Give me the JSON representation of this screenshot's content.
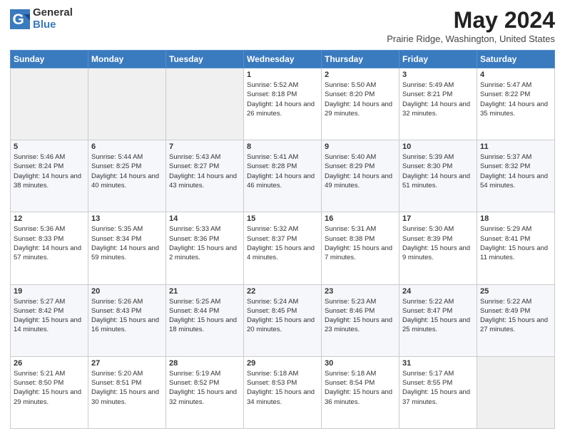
{
  "logo": {
    "general": "General",
    "blue": "Blue"
  },
  "title": {
    "month": "May 2024",
    "location": "Prairie Ridge, Washington, United States"
  },
  "weekdays": [
    "Sunday",
    "Monday",
    "Tuesday",
    "Wednesday",
    "Thursday",
    "Friday",
    "Saturday"
  ],
  "weeks": [
    [
      {
        "day": "",
        "info": ""
      },
      {
        "day": "",
        "info": ""
      },
      {
        "day": "",
        "info": ""
      },
      {
        "day": "1",
        "info": "Sunrise: 5:52 AM\nSunset: 8:18 PM\nDaylight: 14 hours\nand 26 minutes."
      },
      {
        "day": "2",
        "info": "Sunrise: 5:50 AM\nSunset: 8:20 PM\nDaylight: 14 hours\nand 29 minutes."
      },
      {
        "day": "3",
        "info": "Sunrise: 5:49 AM\nSunset: 8:21 PM\nDaylight: 14 hours\nand 32 minutes."
      },
      {
        "day": "4",
        "info": "Sunrise: 5:47 AM\nSunset: 8:22 PM\nDaylight: 14 hours\nand 35 minutes."
      }
    ],
    [
      {
        "day": "5",
        "info": "Sunrise: 5:46 AM\nSunset: 8:24 PM\nDaylight: 14 hours\nand 38 minutes."
      },
      {
        "day": "6",
        "info": "Sunrise: 5:44 AM\nSunset: 8:25 PM\nDaylight: 14 hours\nand 40 minutes."
      },
      {
        "day": "7",
        "info": "Sunrise: 5:43 AM\nSunset: 8:27 PM\nDaylight: 14 hours\nand 43 minutes."
      },
      {
        "day": "8",
        "info": "Sunrise: 5:41 AM\nSunset: 8:28 PM\nDaylight: 14 hours\nand 46 minutes."
      },
      {
        "day": "9",
        "info": "Sunrise: 5:40 AM\nSunset: 8:29 PM\nDaylight: 14 hours\nand 49 minutes."
      },
      {
        "day": "10",
        "info": "Sunrise: 5:39 AM\nSunset: 8:30 PM\nDaylight: 14 hours\nand 51 minutes."
      },
      {
        "day": "11",
        "info": "Sunrise: 5:37 AM\nSunset: 8:32 PM\nDaylight: 14 hours\nand 54 minutes."
      }
    ],
    [
      {
        "day": "12",
        "info": "Sunrise: 5:36 AM\nSunset: 8:33 PM\nDaylight: 14 hours\nand 57 minutes."
      },
      {
        "day": "13",
        "info": "Sunrise: 5:35 AM\nSunset: 8:34 PM\nDaylight: 14 hours\nand 59 minutes."
      },
      {
        "day": "14",
        "info": "Sunrise: 5:33 AM\nSunset: 8:36 PM\nDaylight: 15 hours\nand 2 minutes."
      },
      {
        "day": "15",
        "info": "Sunrise: 5:32 AM\nSunset: 8:37 PM\nDaylight: 15 hours\nand 4 minutes."
      },
      {
        "day": "16",
        "info": "Sunrise: 5:31 AM\nSunset: 8:38 PM\nDaylight: 15 hours\nand 7 minutes."
      },
      {
        "day": "17",
        "info": "Sunrise: 5:30 AM\nSunset: 8:39 PM\nDaylight: 15 hours\nand 9 minutes."
      },
      {
        "day": "18",
        "info": "Sunrise: 5:29 AM\nSunset: 8:41 PM\nDaylight: 15 hours\nand 11 minutes."
      }
    ],
    [
      {
        "day": "19",
        "info": "Sunrise: 5:27 AM\nSunset: 8:42 PM\nDaylight: 15 hours\nand 14 minutes."
      },
      {
        "day": "20",
        "info": "Sunrise: 5:26 AM\nSunset: 8:43 PM\nDaylight: 15 hours\nand 16 minutes."
      },
      {
        "day": "21",
        "info": "Sunrise: 5:25 AM\nSunset: 8:44 PM\nDaylight: 15 hours\nand 18 minutes."
      },
      {
        "day": "22",
        "info": "Sunrise: 5:24 AM\nSunset: 8:45 PM\nDaylight: 15 hours\nand 20 minutes."
      },
      {
        "day": "23",
        "info": "Sunrise: 5:23 AM\nSunset: 8:46 PM\nDaylight: 15 hours\nand 23 minutes."
      },
      {
        "day": "24",
        "info": "Sunrise: 5:22 AM\nSunset: 8:47 PM\nDaylight: 15 hours\nand 25 minutes."
      },
      {
        "day": "25",
        "info": "Sunrise: 5:22 AM\nSunset: 8:49 PM\nDaylight: 15 hours\nand 27 minutes."
      }
    ],
    [
      {
        "day": "26",
        "info": "Sunrise: 5:21 AM\nSunset: 8:50 PM\nDaylight: 15 hours\nand 29 minutes."
      },
      {
        "day": "27",
        "info": "Sunrise: 5:20 AM\nSunset: 8:51 PM\nDaylight: 15 hours\nand 30 minutes."
      },
      {
        "day": "28",
        "info": "Sunrise: 5:19 AM\nSunset: 8:52 PM\nDaylight: 15 hours\nand 32 minutes."
      },
      {
        "day": "29",
        "info": "Sunrise: 5:18 AM\nSunset: 8:53 PM\nDaylight: 15 hours\nand 34 minutes."
      },
      {
        "day": "30",
        "info": "Sunrise: 5:18 AM\nSunset: 8:54 PM\nDaylight: 15 hours\nand 36 minutes."
      },
      {
        "day": "31",
        "info": "Sunrise: 5:17 AM\nSunset: 8:55 PM\nDaylight: 15 hours\nand 37 minutes."
      },
      {
        "day": "",
        "info": ""
      }
    ]
  ]
}
